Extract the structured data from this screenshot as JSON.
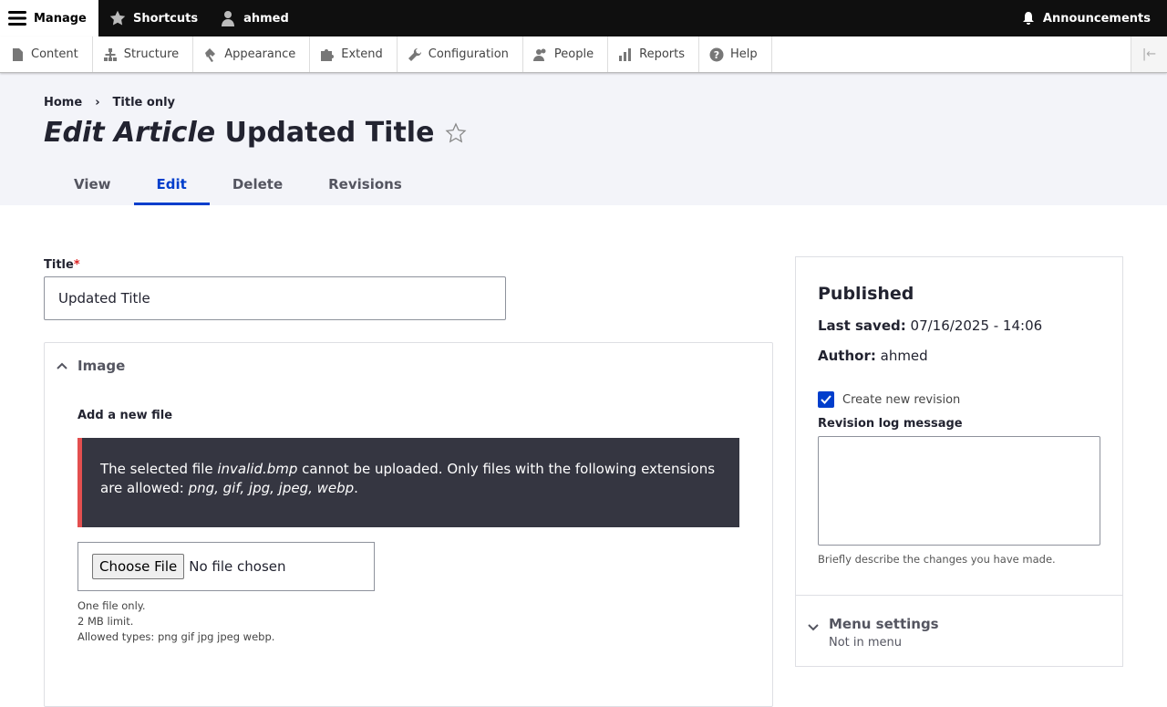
{
  "toolbar": {
    "manage": "Manage",
    "shortcuts": "Shortcuts",
    "user": "ahmed",
    "announcements": "Announcements"
  },
  "tray": [
    {
      "label": "Content",
      "icon": "file-icon"
    },
    {
      "label": "Structure",
      "icon": "sitemap-icon"
    },
    {
      "label": "Appearance",
      "icon": "paint-icon"
    },
    {
      "label": "Extend",
      "icon": "puzzle-icon"
    },
    {
      "label": "Configuration",
      "icon": "wrench-icon"
    },
    {
      "label": "People",
      "icon": "people-icon"
    },
    {
      "label": "Reports",
      "icon": "bar-chart-icon"
    },
    {
      "label": "Help",
      "icon": "help-icon"
    }
  ],
  "breadcrumb": {
    "home": "Home",
    "sep": "›",
    "current": "Title only"
  },
  "page": {
    "title_em": "Edit Article",
    "title_rest": "Updated Title"
  },
  "tabs": [
    "View",
    "Edit",
    "Delete",
    "Revisions"
  ],
  "form": {
    "title_label": "Title",
    "required": "*",
    "title_value": "Updated Title",
    "image_summary": "Image",
    "add_file": "Add a new file",
    "error_pre": "The selected file ",
    "error_file": "invalid.bmp",
    "error_mid": " cannot be uploaded. Only files with the following extensions are allowed: ",
    "error_ext": "png, gif, jpg, jpeg, webp",
    "error_end": ".",
    "choose_file": "Choose File",
    "no_file": "No file chosen",
    "desc1": "One file only.",
    "desc2": "2 MB limit.",
    "desc3": "Allowed types: png gif jpg jpeg webp."
  },
  "sidebar": {
    "status": "Published",
    "last_saved_label": "Last saved:",
    "last_saved": "07/16/2025 - 14:06",
    "author_label": "Author:",
    "author": "ahmed",
    "create_revision": "Create new revision",
    "create_revision_checked": true,
    "revision_label": "Revision log message",
    "revision_value": "",
    "revision_hint": "Briefly describe the changes you have made.",
    "menu_settings": "Menu settings",
    "menu_status": "Not in menu"
  },
  "colors": {
    "accent": "#003ecc",
    "error_border": "#e34f4f",
    "error_bg": "#353641"
  }
}
